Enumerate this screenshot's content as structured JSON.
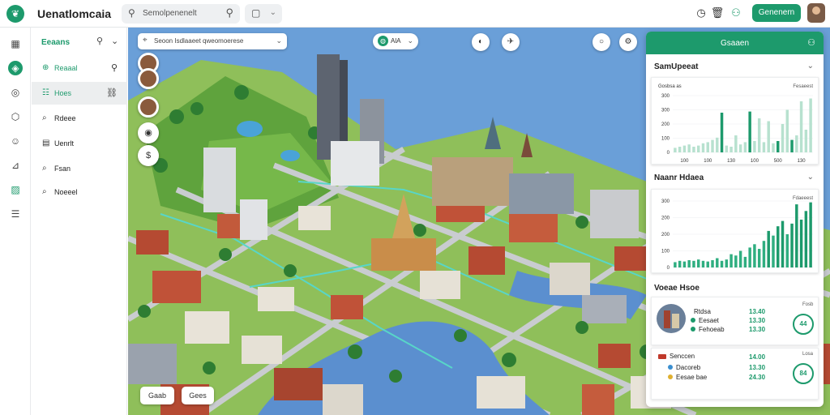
{
  "app": {
    "title": "Uenatlomcaia",
    "logo_icon": "leaf-icon"
  },
  "topbar": {
    "search_placeholder": "Semolpenenelt",
    "primary_button": "Genenern",
    "icons": [
      "clock-icon",
      "trash-icon",
      "users-icon"
    ]
  },
  "rail": {
    "icons": [
      "grid-icon",
      "compass-icon",
      "circle-icon",
      "cube-icon",
      "smile-icon",
      "chart-icon",
      "image-icon",
      "layers-icon"
    ]
  },
  "layers_panel": {
    "title": "Eeaans",
    "items": [
      {
        "label": "Reaaal",
        "icon": "plus-circle-icon",
        "right": "search-icon",
        "selected": false,
        "green": true
      },
      {
        "label": "Hoes",
        "icon": "list-icon",
        "right": "link-icon",
        "selected": true,
        "green": true
      },
      {
        "label": "Rdeee",
        "icon": "pin-icon",
        "right": "",
        "selected": false,
        "green": false
      },
      {
        "label": "Uenrlt",
        "icon": "doc-icon",
        "right": "",
        "selected": false,
        "green": false
      },
      {
        "label": "Fsan",
        "icon": "pin-icon",
        "right": "",
        "selected": false,
        "green": false
      },
      {
        "label": "Noeeel",
        "icon": "pin-icon",
        "right": "",
        "selected": false,
        "green": false
      }
    ]
  },
  "map": {
    "search_text": "Seoon Isdlaaeet qweomoerese",
    "layer_chip": "AlA",
    "bottom_buttons": [
      "Gaab",
      "Gees"
    ]
  },
  "right_panel": {
    "header_title": "Gsaaen",
    "section1_title": "SamUpeeat",
    "section2_title": "Naanr Hdaea",
    "section3_title": "Voeae Hsoe",
    "colors": {
      "accent": "#1d9a6c",
      "accent_light": "#b7e1cf"
    }
  },
  "chart_data": [
    {
      "type": "bar",
      "title": "SamUpeeat",
      "legend_left": "Gosbsa as",
      "legend_right": "Fesaeest",
      "ytick_labels": [
        "0",
        "100",
        "200",
        "300",
        "300"
      ],
      "xtick_labels": [
        "100",
        "100",
        "130",
        "100",
        "500",
        "130"
      ],
      "series": [
        {
          "values": [
            0.08,
            0.1,
            0.12,
            0.14,
            0.1,
            0.12,
            0.16,
            0.18,
            0.22,
            0.26,
            0.7,
            0.12,
            0.1,
            0.3,
            0.14,
            0.18,
            0.72,
            0.2,
            0.6,
            0.18,
            0.55,
            0.16,
            0.2,
            0.5,
            0.75,
            0.22,
            0.3,
            0.9,
            0.4,
            0.95
          ]
        }
      ],
      "highlight": [
        10,
        16,
        22,
        25
      ]
    },
    {
      "type": "bar",
      "title": "Naanr Hdaea",
      "legend_right": "Fdaeeest",
      "ytick_labels": [
        "0",
        "100",
        "200",
        "200",
        "300"
      ],
      "series": [
        {
          "values": [
            0.08,
            0.1,
            0.09,
            0.11,
            0.1,
            0.12,
            0.1,
            0.09,
            0.11,
            0.14,
            0.1,
            0.12,
            0.2,
            0.18,
            0.25,
            0.16,
            0.3,
            0.35,
            0.28,
            0.4,
            0.55,
            0.48,
            0.62,
            0.7,
            0.5,
            0.66,
            0.95,
            0.72,
            0.85,
            0.98
          ]
        }
      ]
    }
  ],
  "trend_rows": [
    {
      "label": "Rtdsa",
      "sub1": "Eesaet",
      "sub2": "Fehoeab",
      "v1": "13.40",
      "v2": "13.30",
      "v3": "13.30",
      "ring": "44",
      "ring_cap": "Fosb"
    },
    {
      "label": "Senccen",
      "sub1": "Dacoreb",
      "sub2": "Eesae bae",
      "v1": "14.00",
      "v2": "13.30",
      "v3": "24.30",
      "ring": "84",
      "ring_cap": "Losa"
    }
  ]
}
